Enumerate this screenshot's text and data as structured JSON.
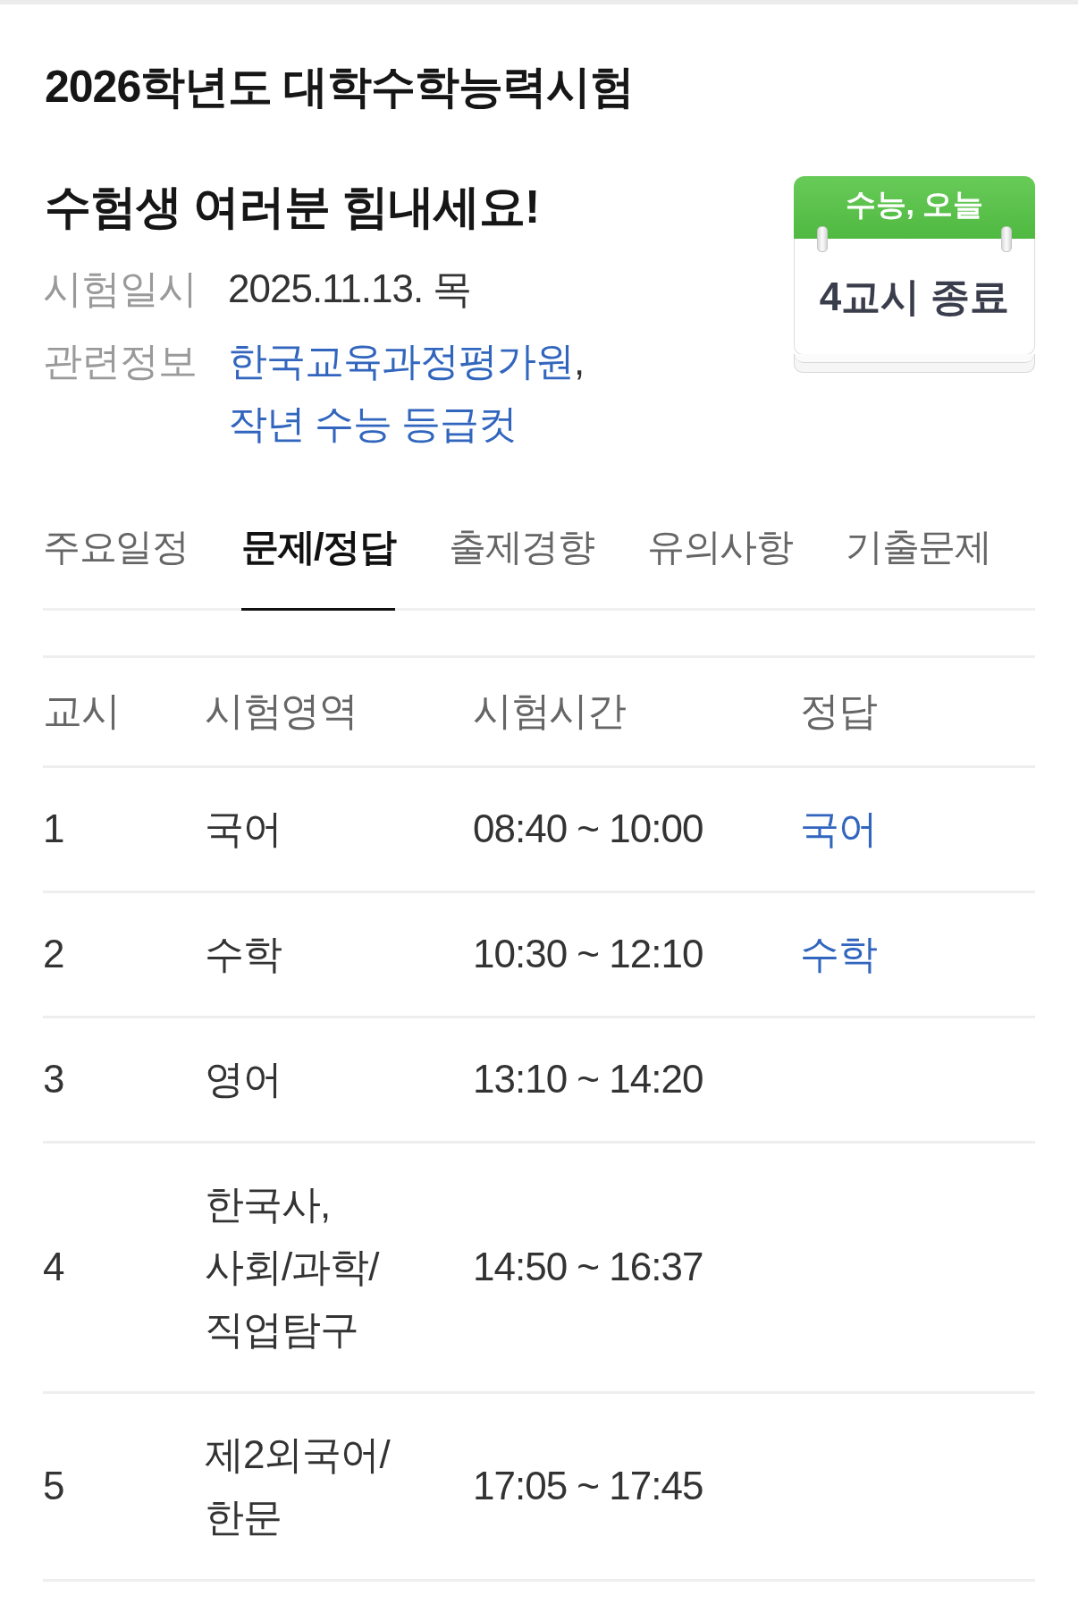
{
  "title": "2026학년도 대학수학능력시험",
  "info": {
    "heading": "수험생 여러분 힘내세요!",
    "rows": [
      {
        "kind": "text",
        "label": "시험일시",
        "value": "2025.11.13. 목"
      },
      {
        "kind": "links",
        "label": "관련정보",
        "links": [
          "한국교육과정평가원",
          "작년 수능 등급컷"
        ],
        "separator": ","
      }
    ]
  },
  "badge": {
    "header": "수능, 오늘",
    "status": "4교시 종료"
  },
  "tabs": [
    {
      "label": "주요일정",
      "selected": false
    },
    {
      "label": "문제/정답",
      "selected": true
    },
    {
      "label": "출제경향",
      "selected": false
    },
    {
      "label": "유의사항",
      "selected": false
    },
    {
      "label": "기출문제",
      "selected": false
    }
  ],
  "table": {
    "columns": [
      "교시",
      "시험영역",
      "시험시간",
      "정답"
    ],
    "rows": [
      {
        "period": "1",
        "subject": "국어",
        "time": "08:40 ~ 10:00",
        "answer": "국어"
      },
      {
        "period": "2",
        "subject": "수학",
        "time": "10:30 ~ 12:10",
        "answer": "수학"
      },
      {
        "period": "3",
        "subject": "영어",
        "time": "13:10 ~ 14:20"
      },
      {
        "period": "4",
        "subject": "한국사, 사회/과학/직업탐구",
        "time": "14:50 ~ 16:37"
      },
      {
        "period": "5",
        "subject": "제2외국어/한문",
        "time": "17:05 ~ 17:45"
      }
    ]
  }
}
